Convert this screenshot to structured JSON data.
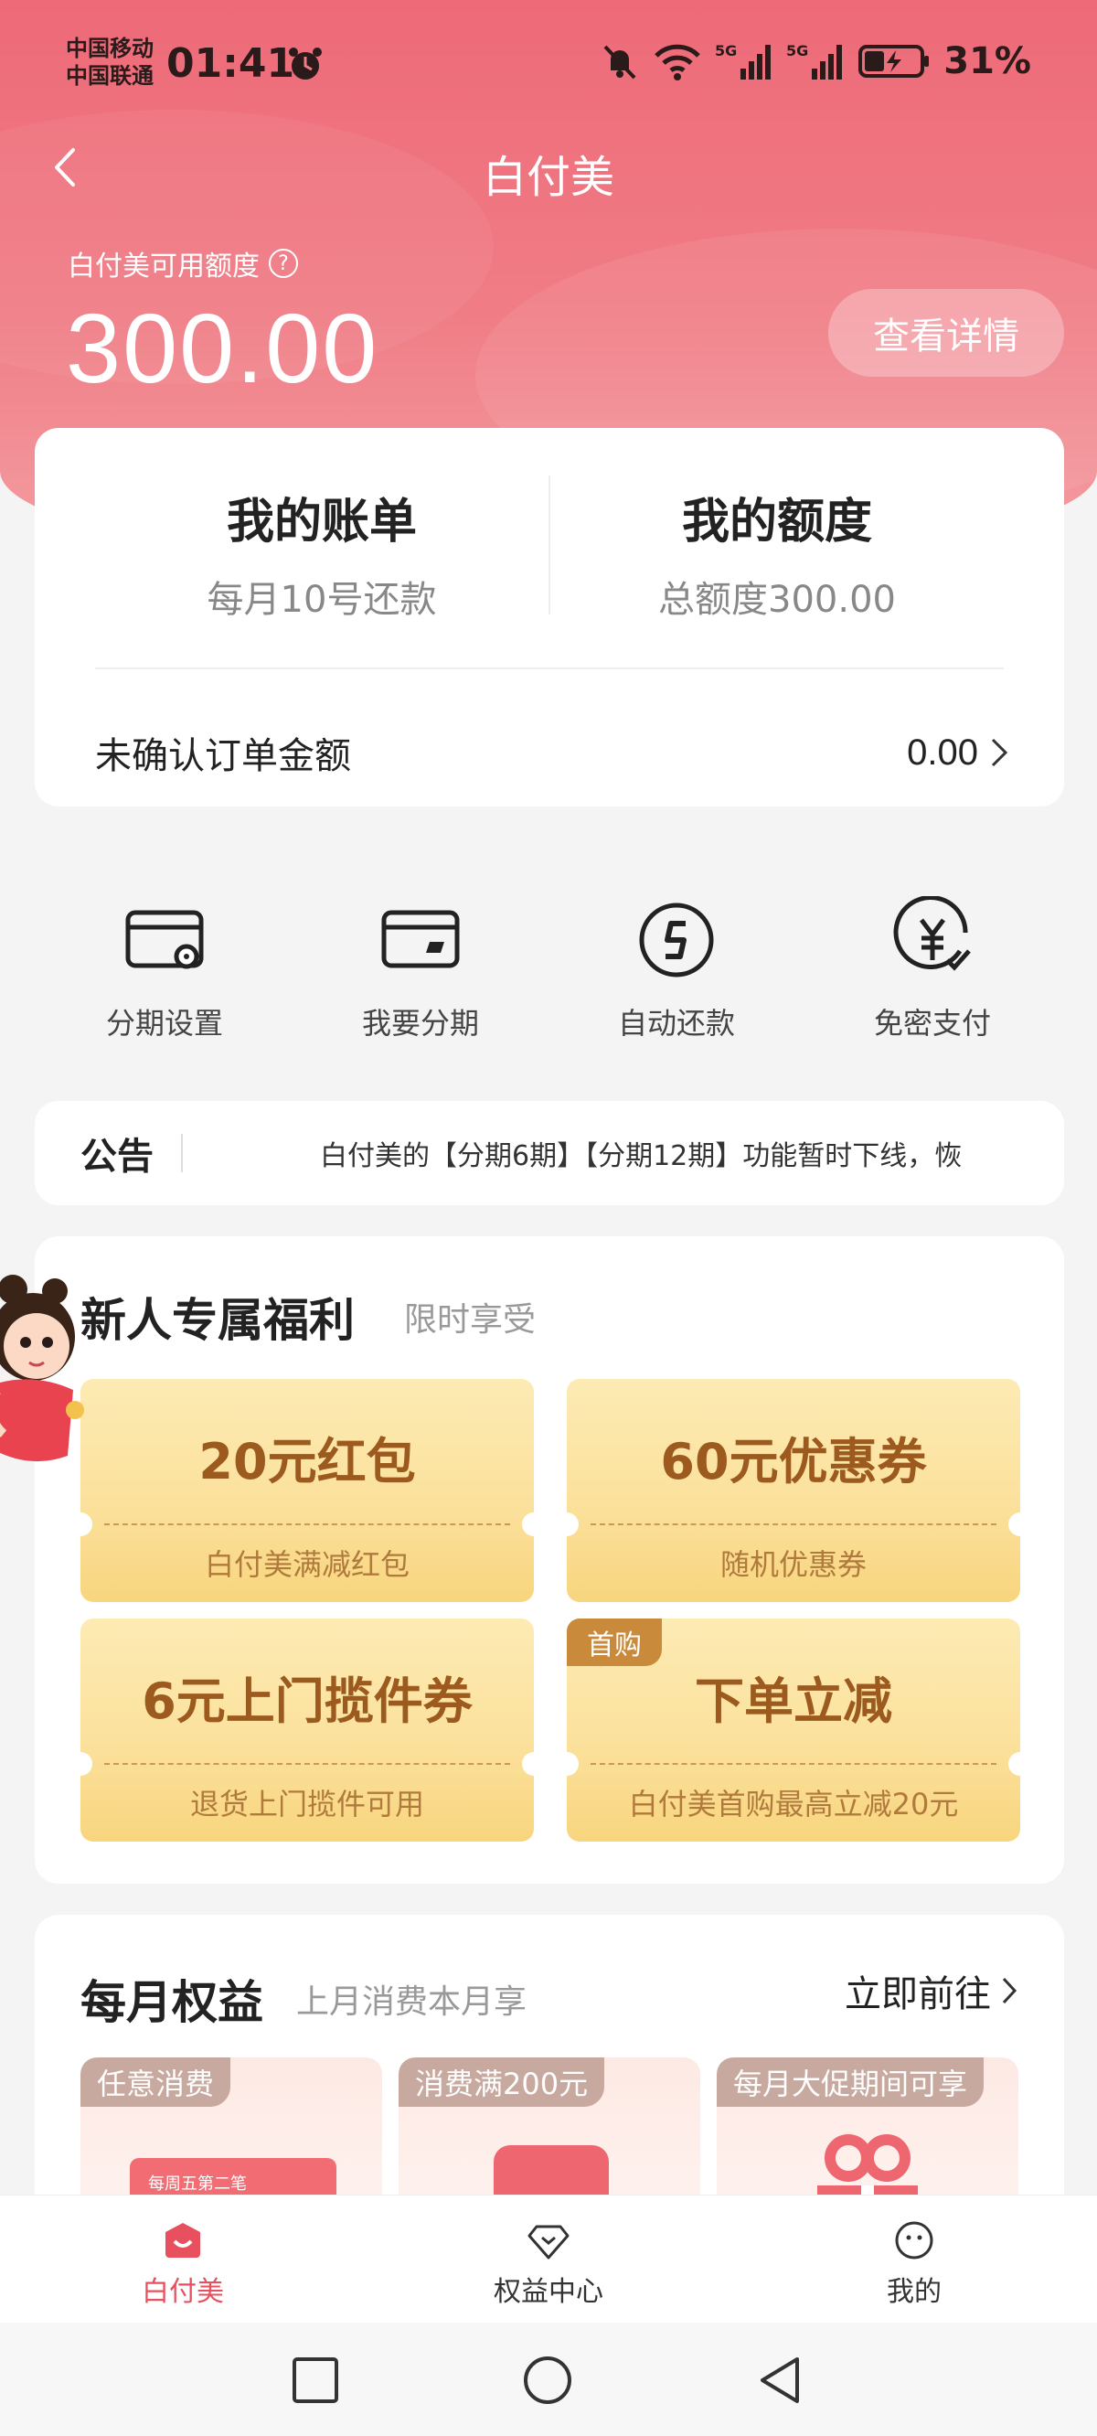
{
  "status_bar": {
    "carrier_1": "中国移动",
    "carrier_2": "中国联通",
    "time": "01:41",
    "battery_percent": "31%",
    "icons": [
      "alarm-icon",
      "mute-icon",
      "wifi-icon",
      "signal-5g-icon",
      "signal-5g-icon",
      "battery-charging-icon"
    ]
  },
  "nav": {
    "title": "白付美",
    "back_icon": "back-arrow-icon"
  },
  "credit": {
    "available_label": "白付美可用额度",
    "help_icon": "question-icon",
    "amount": "300.00",
    "detail_button": "查看详情"
  },
  "summary": {
    "bill_title": "我的账单",
    "bill_sub": "每月10号还款",
    "limit_title": "我的额度",
    "limit_sub": "总额度300.00",
    "unconfirmed_label": "未确认订单金额",
    "unconfirmed_value": "0.00"
  },
  "quick_actions": [
    {
      "label": "分期设置",
      "icon": "card-settings-icon"
    },
    {
      "label": "我要分期",
      "icon": "card-installment-icon"
    },
    {
      "label": "自动还款",
      "icon": "auto-repay-icon"
    },
    {
      "label": "免密支付",
      "icon": "yen-check-icon"
    }
  ],
  "notice": {
    "title": "公告",
    "text": "白付美的【分期6期】【分期12期】功能暂时下线，恢"
  },
  "newbie": {
    "title": "新人专属福利",
    "subtitle": "限时享受",
    "coupons": [
      {
        "title": "20元红包",
        "sub": "白付美满减红包",
        "tag": ""
      },
      {
        "title": "60元优惠券",
        "sub": "随机优惠券",
        "tag": ""
      },
      {
        "title": "6元上门揽件券",
        "sub": "退货上门揽件可用",
        "tag": ""
      },
      {
        "title": "下单立减",
        "sub": "白付美首购最高立减20元",
        "tag": "首购"
      }
    ]
  },
  "monthly": {
    "title": "每月权益",
    "subtitle": "上月消费本月享",
    "go_label": "立即前往",
    "perks": [
      {
        "tag": "任意消费",
        "card_text": "每周五第二笔"
      },
      {
        "tag": "消费满200元"
      },
      {
        "tag": "每月大促期间可享"
      }
    ]
  },
  "tabbar": [
    {
      "label": "白付美",
      "icon": "home-bag-icon",
      "active": true
    },
    {
      "label": "权益中心",
      "icon": "diamond-icon",
      "active": false
    },
    {
      "label": "我的",
      "icon": "profile-face-icon",
      "active": false
    }
  ],
  "colors": {
    "brand": "#ee6a78",
    "active_tab": "#e8505f",
    "coupon_text": "#9c5a1e"
  }
}
